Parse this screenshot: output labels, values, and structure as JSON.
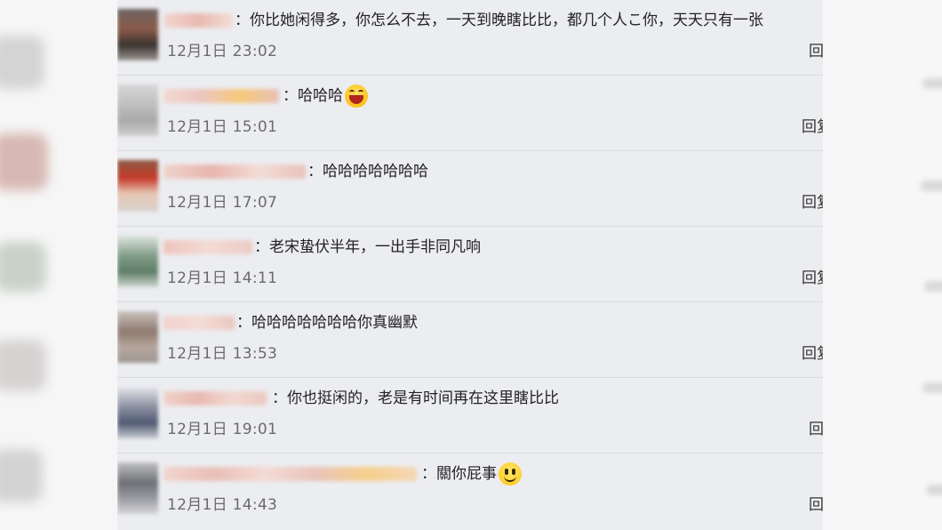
{
  "comments": [
    {
      "text": "：你比她闲得多，你怎么不去，一天到晚瞎比比，都几个人こ你，天天只有一张",
      "time": "12月1日 23:02",
      "reply": "回复",
      "emoji": ""
    },
    {
      "text": "：哈哈哈",
      "time": "12月1日 15:01",
      "reply": "回复",
      "emoji": "laughing-face-icon"
    },
    {
      "text": "：哈哈哈哈哈哈哈",
      "time": "12月1日 17:07",
      "reply": "回复",
      "emoji": ""
    },
    {
      "text": "：老宋蛰伏半年，一出手非同凡响",
      "time": "12月1日 14:11",
      "reply": "回复",
      "emoji": ""
    },
    {
      "text": "：哈哈哈哈哈哈哈你真幽默",
      "time": "12月1日 13:53",
      "reply": "回复",
      "emoji": ""
    },
    {
      "text": "：你也挺闲的，老是有时间再在这里瞎比比",
      "time": "12月1日 19:01",
      "reply": "回复",
      "emoji": ""
    },
    {
      "text": "：關你屁事",
      "time": "12月1日 14:43",
      "reply": "回复",
      "emoji": "smiley-face-icon"
    }
  ]
}
